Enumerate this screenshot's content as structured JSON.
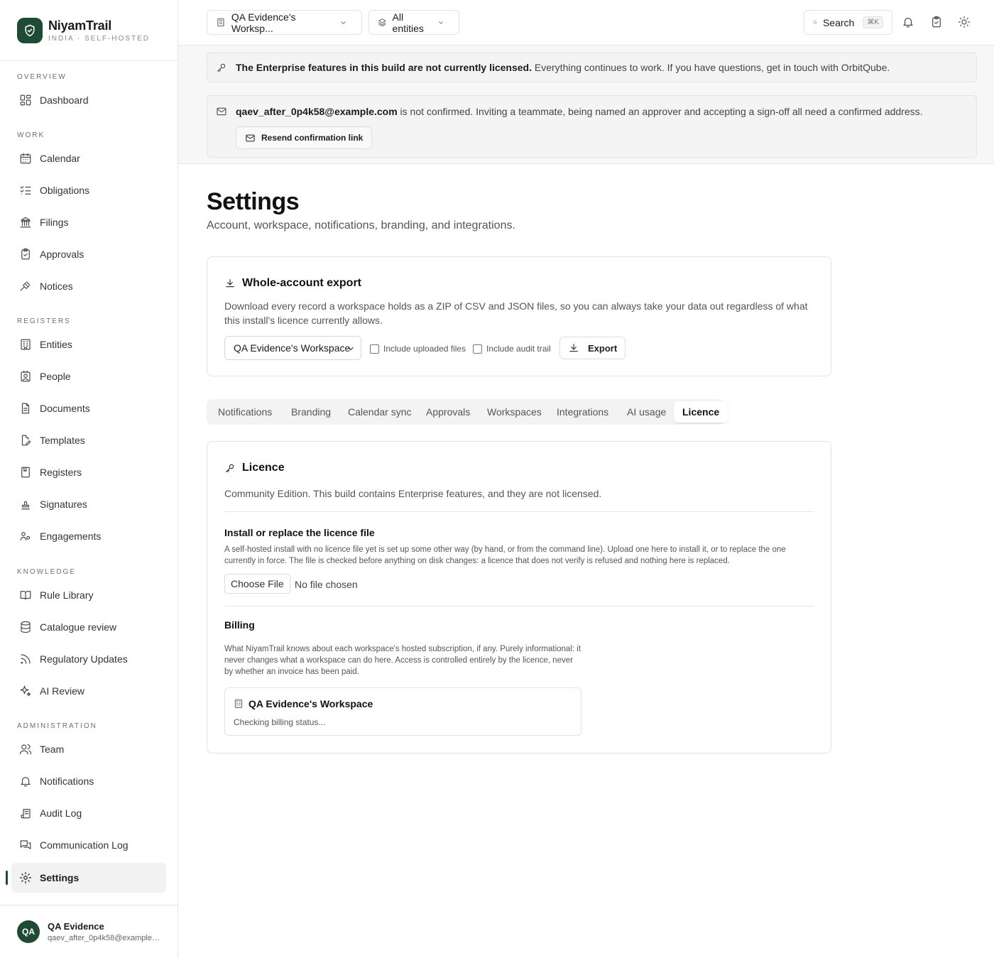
{
  "brand": {
    "name": "NiyamTrail",
    "subtitle": "INDIA · SELF-HOSTED"
  },
  "nav": {
    "sections": [
      "OVERVIEW",
      "WORK",
      "REGISTERS",
      "KNOWLEDGE",
      "ADMINISTRATION"
    ],
    "items": [
      {
        "label": "Dashboard",
        "icon": "dashboard-icon"
      },
      {
        "label": "Calendar",
        "icon": "calendar-icon"
      },
      {
        "label": "Obligations",
        "icon": "list-checks-icon"
      },
      {
        "label": "Filings",
        "icon": "landmark-icon"
      },
      {
        "label": "Approvals",
        "icon": "clipboard-check-icon"
      },
      {
        "label": "Notices",
        "icon": "gavel-icon"
      },
      {
        "label": "Entities",
        "icon": "building-icon"
      },
      {
        "label": "People",
        "icon": "contact-icon"
      },
      {
        "label": "Documents",
        "icon": "file-text-icon"
      },
      {
        "label": "Templates",
        "icon": "file-pen-icon"
      },
      {
        "label": "Registers",
        "icon": "book-icon"
      },
      {
        "label": "Signatures",
        "icon": "stamp-icon"
      },
      {
        "label": "Engagements",
        "icon": "users-icon"
      },
      {
        "label": "Rule Library",
        "icon": "book-open-icon"
      },
      {
        "label": "Catalogue review",
        "icon": "database-icon"
      },
      {
        "label": "Regulatory Updates",
        "icon": "rss-icon"
      },
      {
        "label": "AI Review",
        "icon": "sparkles-icon"
      },
      {
        "label": "Team",
        "icon": "team-icon"
      },
      {
        "label": "Notifications",
        "icon": "bell-icon"
      },
      {
        "label": "Audit Log",
        "icon": "scroll-icon"
      },
      {
        "label": "Communication Log",
        "icon": "messages-icon"
      },
      {
        "label": "Settings",
        "icon": "gear-icon"
      }
    ]
  },
  "user": {
    "initials": "QA",
    "name": "QA Evidence",
    "email": "qaev_after_0p4k58@example.com"
  },
  "topbar": {
    "workspace": "QA Evidence's Worksp...",
    "entities": "All entities",
    "search_label": "Search",
    "search_shortcut": "⌘K"
  },
  "banners": {
    "licence_bold": "The Enterprise features in this build are not currently licensed.",
    "licence_rest": " Everything continues to work. If you have questions, get in touch with OrbitQube.",
    "email_bold": "qaev_after_0p4k58@example.com",
    "email_rest": " is not confirmed. Inviting a teammate, being named an approver and accepting a sign-off all need a confirmed address.",
    "resend_label": "Resend confirmation link"
  },
  "page": {
    "title": "Settings",
    "subtitle": "Account, workspace, notifications, branding, and integrations."
  },
  "export": {
    "title": "Whole-account export",
    "description": "Download every record a workspace holds as a ZIP of CSV and JSON files, so you can always take your data out regardless of what this install's licence currently allows.",
    "workspace_selected": "QA Evidence's Workspace",
    "include_files": "Include uploaded files",
    "include_audit": "Include audit trail",
    "export_label": "Export"
  },
  "tabs": [
    "Notifications",
    "Branding",
    "Calendar sync",
    "Approvals",
    "Workspaces",
    "Integrations",
    "AI usage",
    "Licence"
  ],
  "licence": {
    "title": "Licence",
    "edition": "Community Edition. This build contains Enterprise features, and they are not licensed.",
    "install_title": "Install or replace the licence file",
    "install_desc": "A self-hosted install with no licence file yet is set up some other way (by hand, or from the command line). Upload one here to install it, or to replace the one currently in force. The file is checked before anything on disk changes: a licence that does not verify is refused and nothing here is replaced.",
    "choose_file": "Choose File",
    "no_file": "No file chosen",
    "billing_title": "Billing",
    "billing_desc": "What NiyamTrail knows about each workspace's hosted subscription, if any. Purely informational: it never changes what a workspace can do here. Access is controlled entirely by the licence, never by whether an invoice has been paid.",
    "workspace_name": "QA Evidence's Workspace",
    "billing_status": "Checking billing status..."
  },
  "colors": {
    "brand": "#1f4a35",
    "border": "#e3e3e3",
    "banner_bg": "#f4f4f4"
  }
}
